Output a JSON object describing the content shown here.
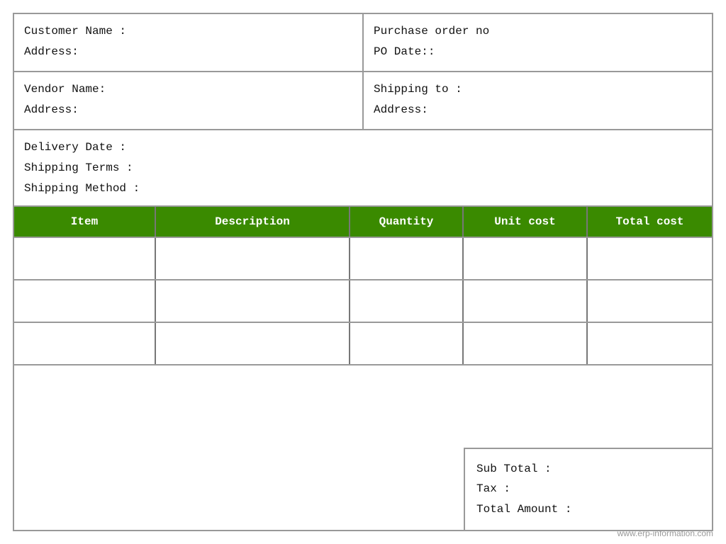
{
  "header": {
    "customer_name_label": "Customer Name :",
    "address_label": "Address:",
    "po_label": "Purchase order no",
    "po_date_label": "PO Date::",
    "vendor_name_label": "Vendor Name:",
    "vendor_address_label": " Address:",
    "shipping_to_label": "Shipping to :",
    "shipping_address_label": "  Address:",
    "delivery_date_label": "Delivery Date :",
    "shipping_terms_label": "Shipping Terms :",
    "shipping_method_label": "Shipping Method :"
  },
  "table": {
    "columns": [
      {
        "id": "item",
        "label": "Item"
      },
      {
        "id": "description",
        "label": "Description"
      },
      {
        "id": "quantity",
        "label": "Quantity"
      },
      {
        "id": "unit_cost",
        "label": "Unit cost"
      },
      {
        "id": "total_cost",
        "label": "Total cost"
      }
    ],
    "rows": [
      {
        "item": "",
        "description": "",
        "quantity": "",
        "unit_cost": "",
        "total_cost": ""
      },
      {
        "item": "",
        "description": "",
        "quantity": "",
        "unit_cost": "",
        "total_cost": ""
      },
      {
        "item": "",
        "description": "",
        "quantity": "",
        "unit_cost": "",
        "total_cost": ""
      }
    ]
  },
  "summary": {
    "subtotal_label": "Sub Total :",
    "tax_label": "Tax :",
    "total_label": "Total Amount :"
  },
  "watermark": "www.erp-information.com"
}
